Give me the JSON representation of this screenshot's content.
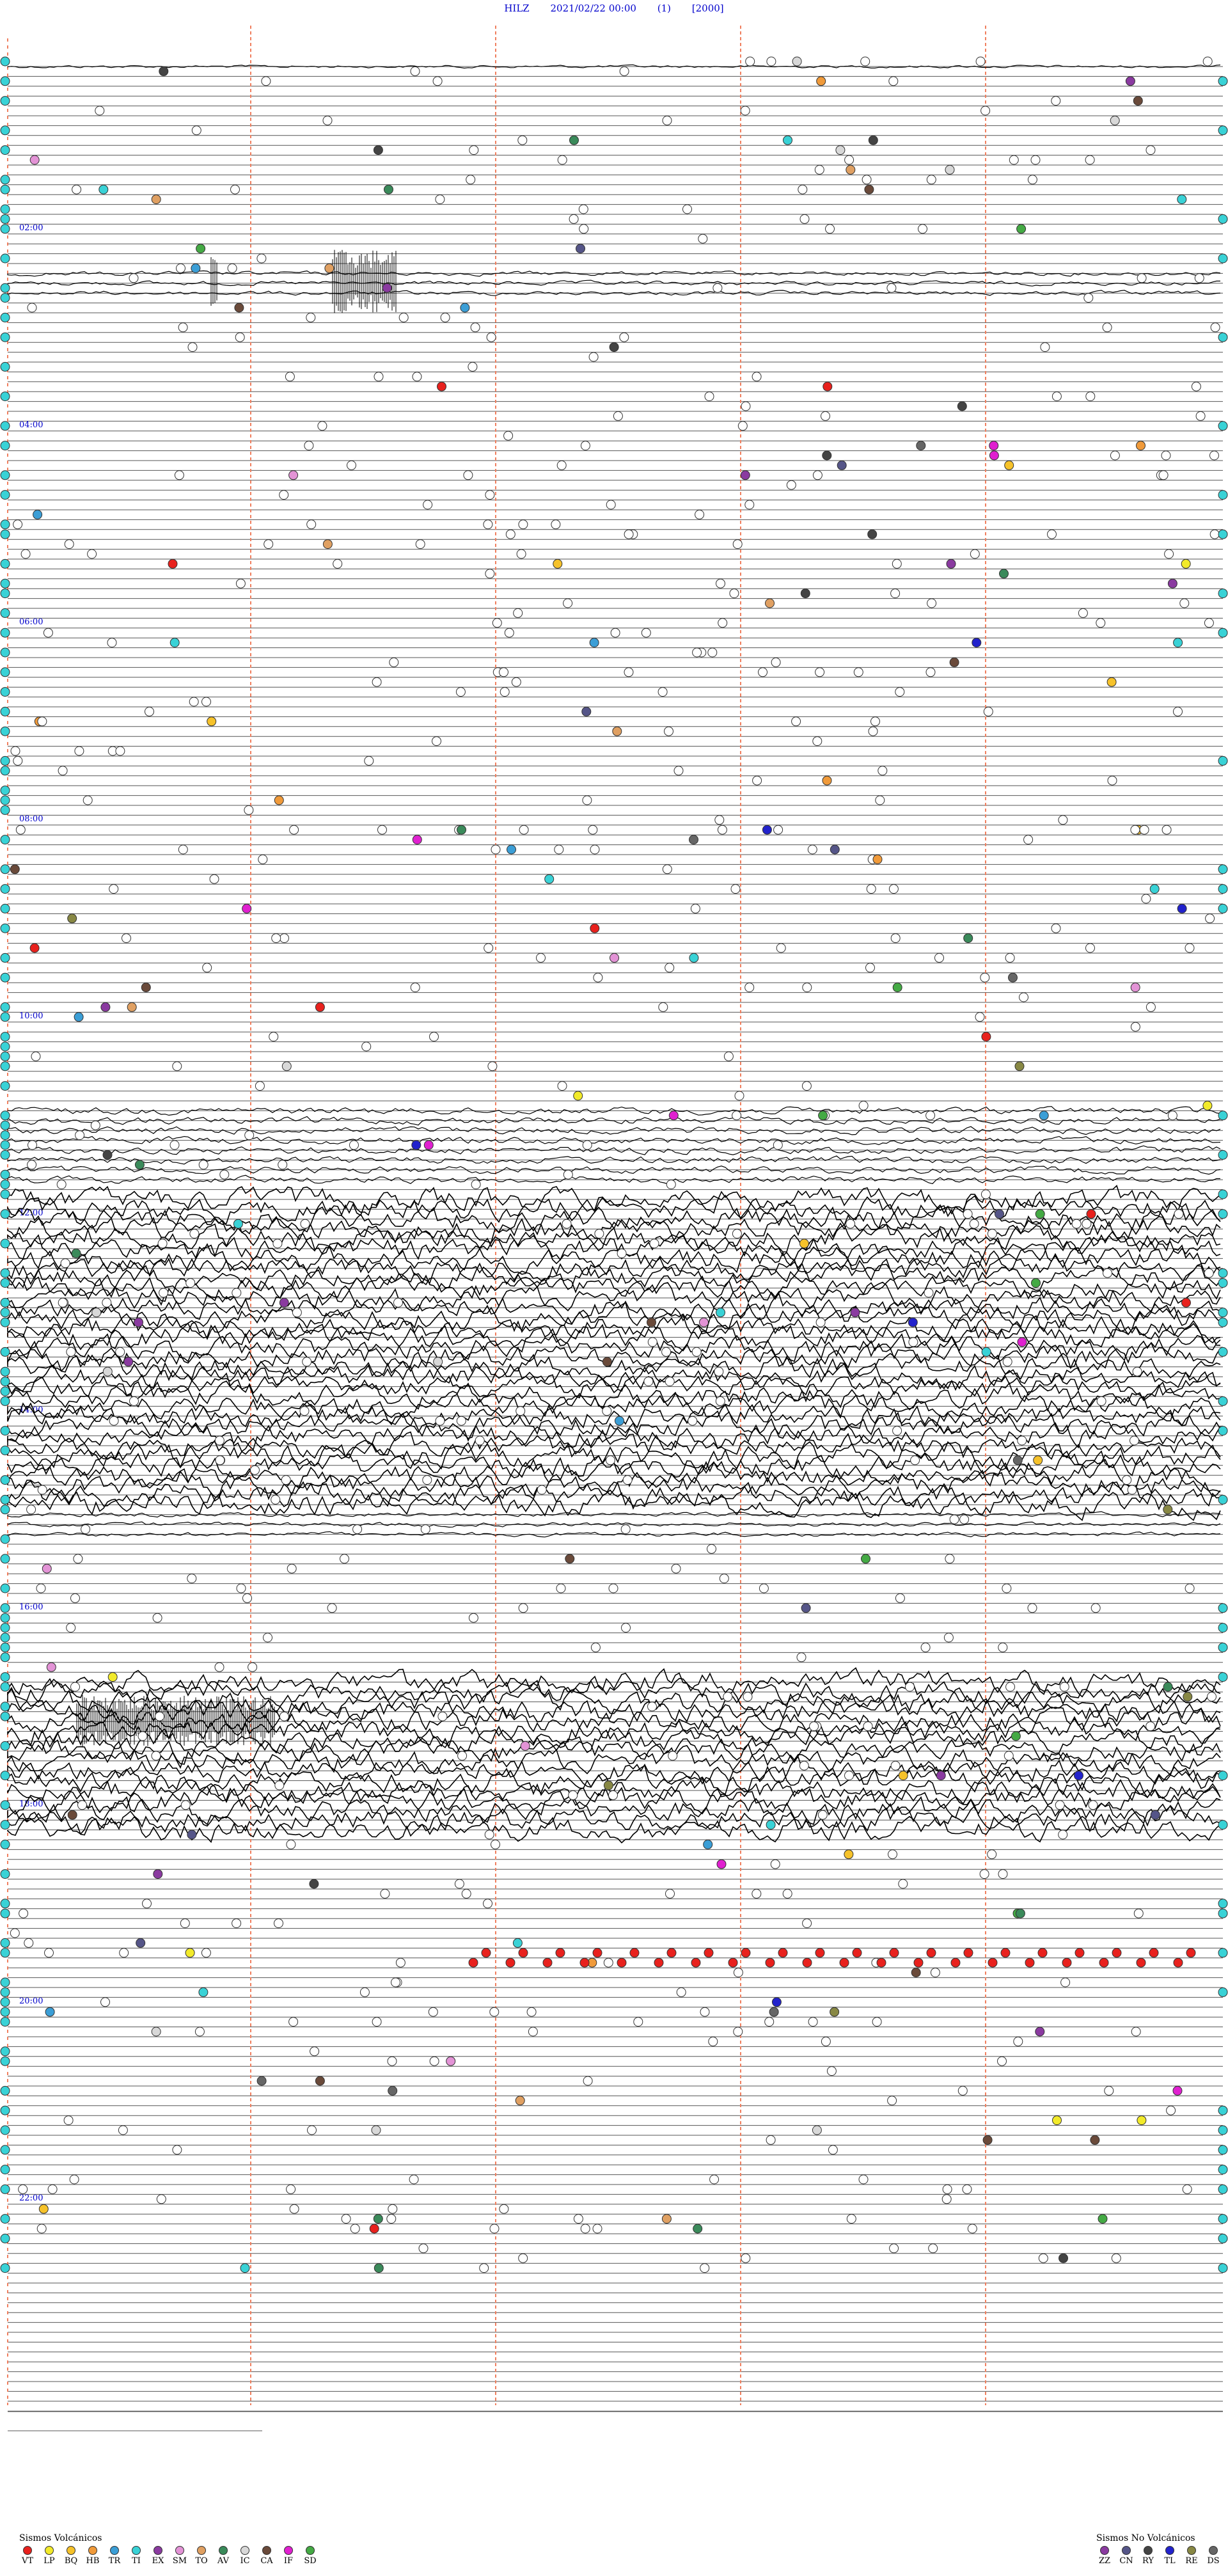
{
  "header": {
    "station": "HILZ",
    "datetime": "2021/02/22 00:00",
    "component": "(1)",
    "scale": "[2000]"
  },
  "chart_data": {
    "type": "helicorder",
    "title": "HILZ   2021/02/22 00:00   (1)   [2000]",
    "hour_labels": [
      "02:00",
      "04:00",
      "06:00",
      "08:00",
      "10:00",
      "12:00",
      "14:00",
      "16:00",
      "18:00",
      "20:00",
      "22:00"
    ],
    "trace_count": 144,
    "traces_per_hour": 6,
    "dashed_column_count": 5,
    "activity_segments": [
      {
        "from_trace": 0,
        "to_trace": 1,
        "level": "low"
      },
      {
        "from_trace": 21,
        "to_trace": 24,
        "level": "burst"
      },
      {
        "from_trace": 106,
        "to_trace": 114,
        "level": "medium"
      },
      {
        "from_trace": 115,
        "to_trace": 147,
        "level": "high"
      },
      {
        "from_trace": 147,
        "to_trace": 150,
        "level": "burst"
      },
      {
        "from_trace": 164,
        "to_trace": 180,
        "level": "high"
      }
    ],
    "dot_density": "high",
    "event_classes_volcanic": [
      {
        "code": "VT",
        "color": "#e8211d"
      },
      {
        "code": "LP",
        "color": "#f2ea2a"
      },
      {
        "code": "BQ",
        "color": "#f6c22a"
      },
      {
        "code": "HB",
        "color": "#f09a3a"
      },
      {
        "code": "TR",
        "color": "#3b9ed6"
      },
      {
        "code": "TI",
        "color": "#39d2d6"
      },
      {
        "code": "EX",
        "color": "#8a3aa0"
      },
      {
        "code": "SM",
        "color": "#e393d6"
      },
      {
        "code": "TO",
        "color": "#e0a062"
      },
      {
        "code": "AV",
        "color": "#3a8a5a"
      },
      {
        "code": "IC",
        "color": "#d8d8d8"
      },
      {
        "code": "CA",
        "color": "#6a4a3a"
      },
      {
        "code": "IF",
        "color": "#e020d0"
      },
      {
        "code": "SD",
        "color": "#44aa44"
      }
    ],
    "event_classes_nonvolcanic": [
      {
        "code": "ZZ",
        "color": "#8a3aa0"
      },
      {
        "code": "CN",
        "color": "#555588"
      },
      {
        "code": "RY",
        "color": "#444444"
      },
      {
        "code": "TL",
        "color": "#2222cc"
      },
      {
        "code": "RE",
        "color": "#888844"
      },
      {
        "code": "DS",
        "color": "#666666"
      }
    ]
  },
  "legend": {
    "volcanic_title": "Sismos Volcánicos",
    "nonvolcanic_title": "Sismos No Volcánicos"
  }
}
